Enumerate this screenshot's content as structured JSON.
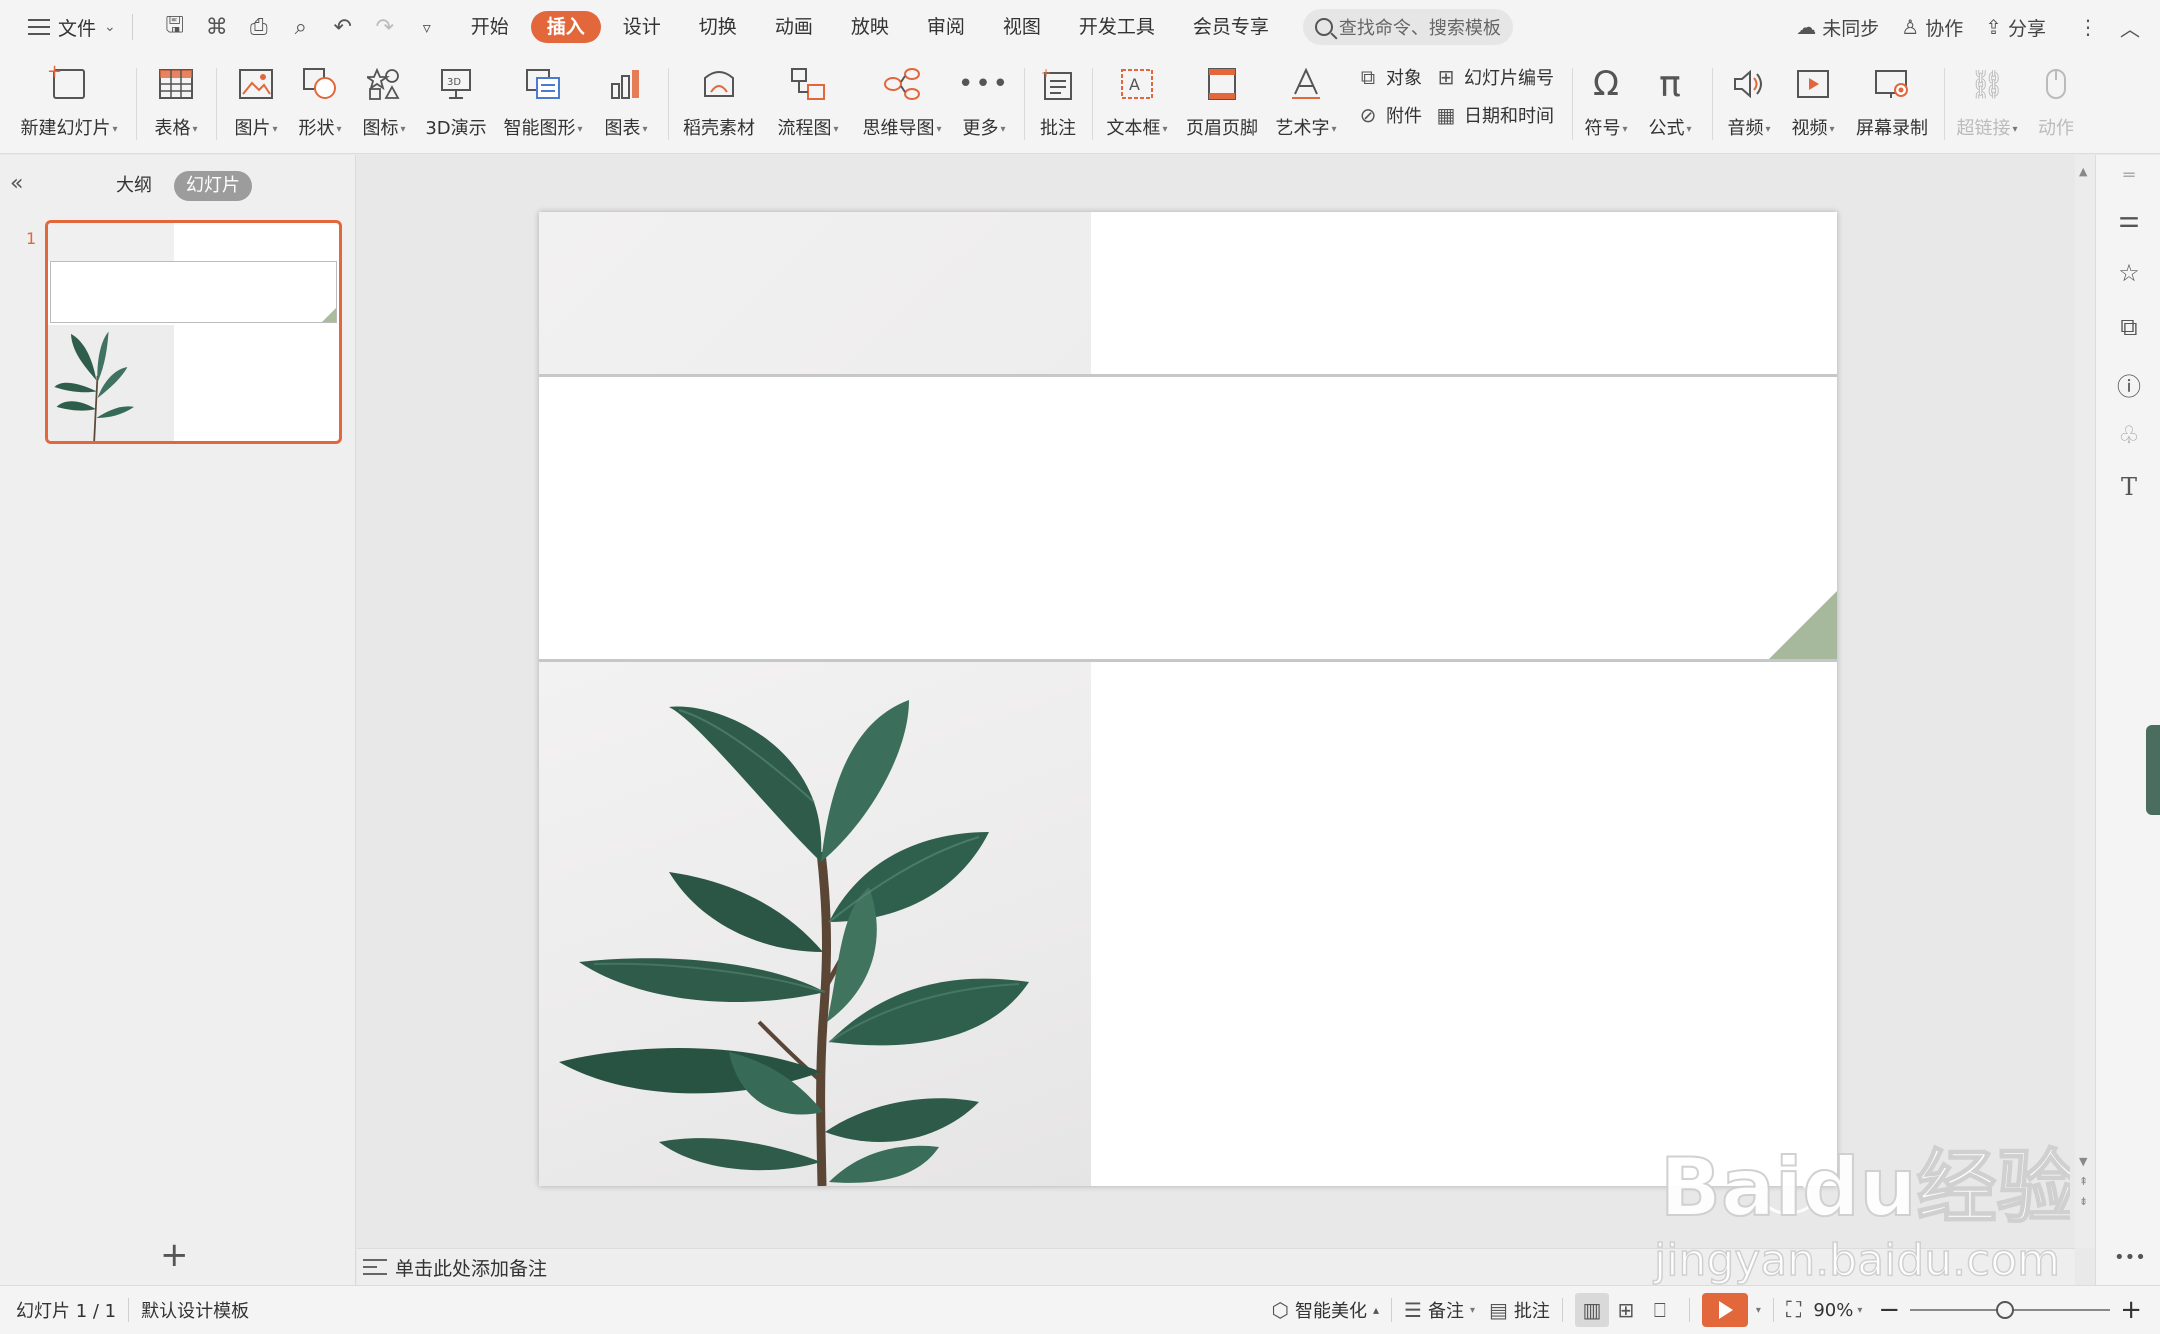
{
  "menubar": {
    "file_label": "文件",
    "tabs": [
      {
        "label": "开始"
      },
      {
        "label": "插入",
        "active": true
      },
      {
        "label": "设计"
      },
      {
        "label": "切换"
      },
      {
        "label": "动画"
      },
      {
        "label": "放映"
      },
      {
        "label": "审阅"
      },
      {
        "label": "视图"
      },
      {
        "label": "开发工具"
      },
      {
        "label": "会员专享"
      }
    ],
    "search_placeholder": "查找命令、搜索模板",
    "sync_label": "未同步",
    "collab_label": "协作",
    "share_label": "分享"
  },
  "ribbon": {
    "new_slide": "新建幻灯片",
    "table": "表格",
    "picture": "图片",
    "shape": "形状",
    "icon": "图标",
    "demo3d": "3D演示",
    "smartart": "智能图形",
    "chart": "图表",
    "material": "稻壳素材",
    "flowchart": "流程图",
    "mindmap": "思维导图",
    "more": "更多",
    "comment": "批注",
    "textbox": "文本框",
    "header_footer": "页眉页脚",
    "wordart": "艺术字",
    "object": "对象",
    "attachment": "附件",
    "slide_number": "幻灯片编号",
    "datetime": "日期和时间",
    "symbol": "符号",
    "formula": "公式",
    "audio": "音频",
    "video": "视频",
    "screen_record": "屏幕录制",
    "hyperlink": "超链接",
    "action": "动作"
  },
  "leftpanel": {
    "tab_outline": "大纲",
    "tab_slides": "幻灯片",
    "slide_number": "1"
  },
  "notes": {
    "placeholder": "单击此处添加备注"
  },
  "statusbar": {
    "slide_info": "幻灯片 1 / 1",
    "template": "默认设计模板",
    "beautify": "智能美化",
    "notes": "备注",
    "comment": "批注",
    "zoom": "90%"
  },
  "watermark": {
    "brand": "Baidu经验",
    "url": "jingyan.baidu.com"
  },
  "colors": {
    "accent": "#e2683c",
    "leaf_dark": "#2f5d4c",
    "leaf_mid": "#3f7260",
    "corner_green": "#a6b99c"
  }
}
